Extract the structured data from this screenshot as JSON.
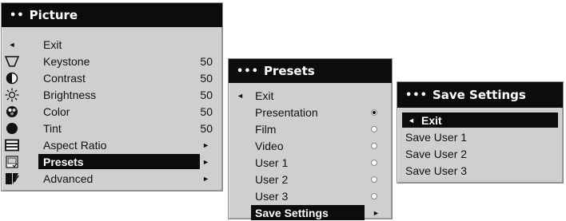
{
  "picture_menu": {
    "title": "Picture",
    "title_dots": "••",
    "items": [
      {
        "label": "Exit",
        "icon": "left-arrow-icon",
        "value": "",
        "arrow": ""
      },
      {
        "label": "Keystone",
        "icon": "keystone-icon",
        "value": "50",
        "arrow": ""
      },
      {
        "label": "Contrast",
        "icon": "contrast-icon",
        "value": "50",
        "arrow": ""
      },
      {
        "label": "Brightness",
        "icon": "brightness-icon",
        "value": "50",
        "arrow": ""
      },
      {
        "label": "Color",
        "icon": "color-icon",
        "value": "50",
        "arrow": ""
      },
      {
        "label": "Tint",
        "icon": "tint-icon",
        "value": "50",
        "arrow": ""
      },
      {
        "label": "Aspect Ratio",
        "icon": "aspect-ratio-icon",
        "value": "",
        "arrow": "►"
      },
      {
        "label": "Presets",
        "icon": "presets-icon",
        "value": "",
        "arrow": "►"
      },
      {
        "label": "Advanced",
        "icon": "advanced-icon",
        "value": "",
        "arrow": "►"
      }
    ],
    "selected": "Presets"
  },
  "presets_menu": {
    "title": "Presets",
    "title_dots": "•••",
    "exit_label": "Exit",
    "exit_arrow": "◄",
    "options": [
      {
        "label": "Presentation",
        "checked": true
      },
      {
        "label": "Film",
        "checked": false
      },
      {
        "label": "Video",
        "checked": false
      },
      {
        "label": "User 1",
        "checked": false
      },
      {
        "label": "User 2",
        "checked": false
      },
      {
        "label": "User 3",
        "checked": false
      }
    ],
    "save_settings_label": "Save Settings",
    "save_settings_arrow": "►",
    "selected": "Save Settings"
  },
  "save_settings_menu": {
    "title": "Save Settings",
    "title_dots": "•••",
    "exit_label": "Exit",
    "exit_arrow": "◄",
    "items": [
      "Save User 1",
      "Save User 2",
      "Save User 3"
    ],
    "selected": "Exit"
  }
}
